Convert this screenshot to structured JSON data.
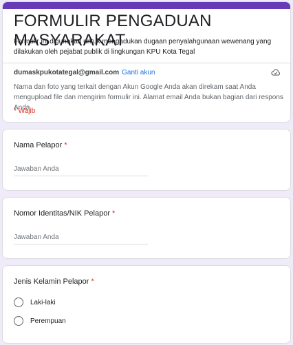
{
  "header": {
    "title": "FORMULIR PENGADUAN MASYARAKAT",
    "description": "Formulir ini digunakan untuk mengadukan dugaan penyalahgunaan wewenang yang dilakukan oleh pejabat publik di lingkungan KPU Kota Tegal",
    "account_email": "dumaskpukotategal@gmail.com",
    "switch_account": "Ganti akun",
    "notice": "Nama dan foto yang terkait dengan Akun Google Anda akan direkam saat Anda mengupload file dan mengirim formulir ini. Alamat email Anda bukan bagian dari respons Anda.",
    "required_note": "* Wajib",
    "icon": "cloud-save-icon"
  },
  "questions": [
    {
      "title": "Nama Pelapor",
      "required_mark": "*",
      "placeholder": "Jawaban Anda"
    },
    {
      "title": "Nomor Identitas/NIK Pelapor",
      "required_mark": "*",
      "placeholder": "Jawaban Anda"
    },
    {
      "title": "Jenis Kelamin Pelapor",
      "required_mark": "*",
      "options": [
        "Laki-laki",
        "Perempuan"
      ]
    }
  ],
  "colors": {
    "accent": "#673ab7",
    "background": "#f0ebf8",
    "required": "#d93025",
    "link": "#1a73e8"
  }
}
